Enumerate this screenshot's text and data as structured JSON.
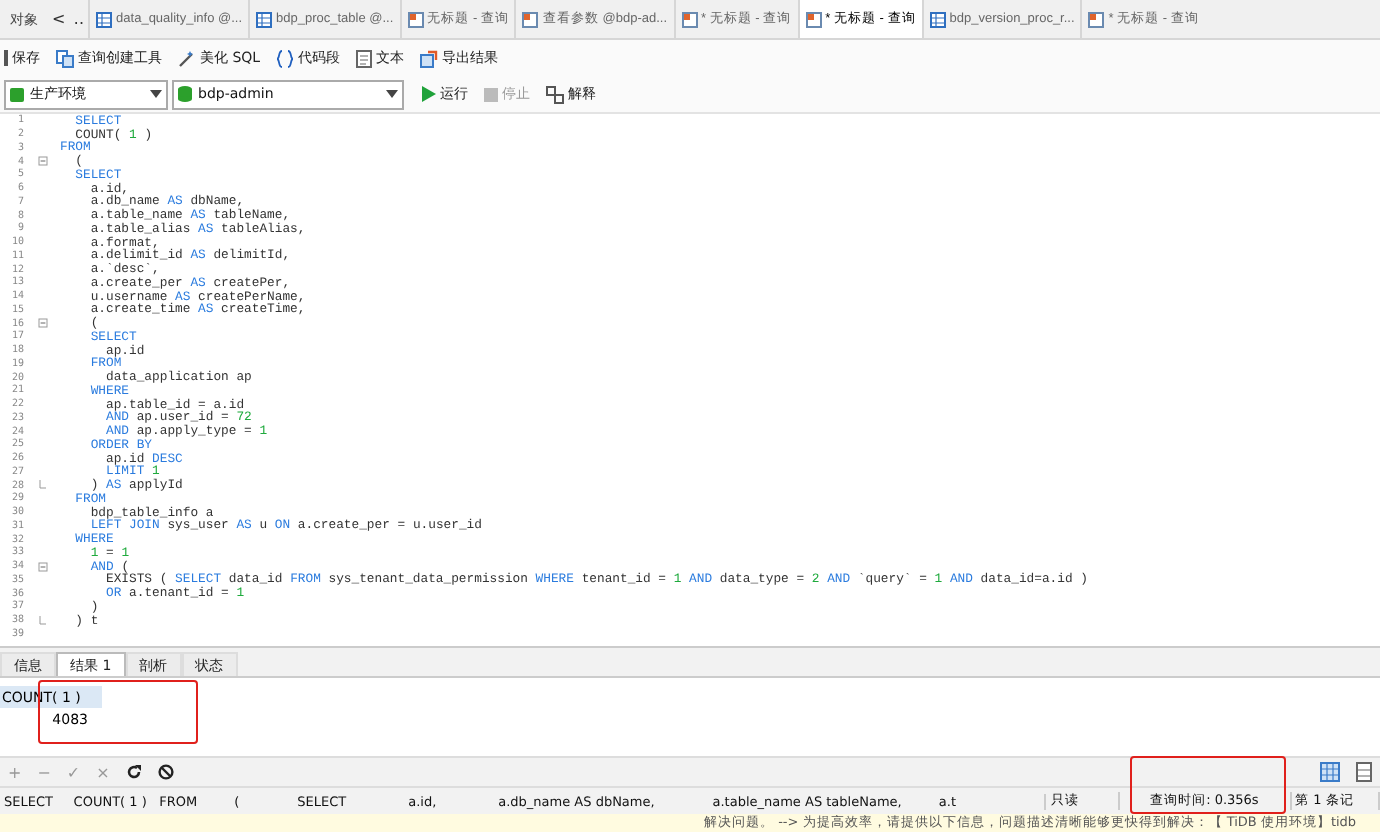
{
  "doc_tabs": {
    "objects_label": "对象",
    "nav": [
      "<",
      "‥"
    ],
    "items": [
      {
        "label": "data_quality_info @...",
        "kind": "table",
        "selected": false
      },
      {
        "label": "bdp_proc_table @...",
        "kind": "table",
        "selected": false
      },
      {
        "label": "无标题 - 查询",
        "kind": "query",
        "selected": false
      },
      {
        "label": "查看参数 @bdp-ad...",
        "kind": "query",
        "selected": false
      },
      {
        "label": "* 无标题 - 查询",
        "kind": "query",
        "selected": false
      },
      {
        "label": "* 无标题 - 查询",
        "kind": "query",
        "selected": true
      },
      {
        "label": "bdp_version_proc_r...",
        "kind": "table",
        "selected": false
      },
      {
        "label": "* 无标题 - 查询",
        "kind": "query",
        "selected": false
      }
    ]
  },
  "toolbar": [
    "保存",
    "查询创建工具",
    "美化 SQL",
    "代码段",
    "文本",
    "导出结果"
  ],
  "connection": {
    "environment": "生产环境",
    "database": "bdp-admin"
  },
  "run_bar": [
    {
      "label": "运行",
      "disabled": false
    },
    {
      "label": "停止",
      "disabled": true
    },
    {
      "label": "解释",
      "disabled": false
    }
  ],
  "code": [
    {
      "n": "1",
      "s": [
        {
          "t": "  SELECT",
          "kind": "kw"
        }
      ]
    },
    {
      "n": "2",
      "s": [
        {
          "t": "  COUNT( ",
          "kind": "p"
        },
        {
          "t": "1",
          "kind": "num"
        },
        {
          "t": " )",
          "kind": "p"
        }
      ]
    },
    {
      "n": "3",
      "s": [
        {
          "t": "FROM",
          "kind": "kw"
        }
      ]
    },
    {
      "n": "4",
      "kind": "fold",
      "s": [
        {
          "t": "  (",
          "kind": "p"
        }
      ]
    },
    {
      "n": "5",
      "s": [
        {
          "t": "  SELECT",
          "kind": "kw"
        }
      ]
    },
    {
      "n": "6",
      "s": [
        {
          "t": "    a.id,",
          "kind": "p"
        }
      ]
    },
    {
      "n": "7",
      "s": [
        {
          "t": "    a.db_name ",
          "kind": "p"
        },
        {
          "t": "AS",
          "kind": "kw"
        },
        {
          "t": " dbName,",
          "kind": "p"
        }
      ]
    },
    {
      "n": "8",
      "s": [
        {
          "t": "    a.table_name ",
          "kind": "p"
        },
        {
          "t": "AS",
          "kind": "kw"
        },
        {
          "t": " tableName,",
          "kind": "p"
        }
      ]
    },
    {
      "n": "9",
      "s": [
        {
          "t": "    a.table_alias ",
          "kind": "p"
        },
        {
          "t": "AS",
          "kind": "kw"
        },
        {
          "t": " tableAlias,",
          "kind": "p"
        }
      ]
    },
    {
      "n": "10",
      "s": [
        {
          "t": "    a.format,",
          "kind": "p"
        }
      ]
    },
    {
      "n": "11",
      "s": [
        {
          "t": "    a.delimit_id ",
          "kind": "p"
        },
        {
          "t": "AS",
          "kind": "kw"
        },
        {
          "t": " delimitId,",
          "kind": "p"
        }
      ]
    },
    {
      "n": "12",
      "s": [
        {
          "t": "    a.`desc`,",
          "kind": "p"
        }
      ]
    },
    {
      "n": "13",
      "s": [
        {
          "t": "    a.create_per ",
          "kind": "p"
        },
        {
          "t": "AS",
          "kind": "kw"
        },
        {
          "t": " createPer,",
          "kind": "p"
        }
      ]
    },
    {
      "n": "14",
      "s": [
        {
          "t": "    u.username ",
          "kind": "p"
        },
        {
          "t": "AS",
          "kind": "kw"
        },
        {
          "t": " createPerName,",
          "kind": "p"
        }
      ]
    },
    {
      "n": "15",
      "s": [
        {
          "t": "    a.create_time ",
          "kind": "p"
        },
        {
          "t": "AS",
          "kind": "kw"
        },
        {
          "t": " createTime,",
          "kind": "p"
        }
      ]
    },
    {
      "n": "16",
      "kind": "fold",
      "s": [
        {
          "t": "    (",
          "kind": "p"
        }
      ]
    },
    {
      "n": "17",
      "s": [
        {
          "t": "    SELECT",
          "kind": "kw"
        }
      ]
    },
    {
      "n": "18",
      "s": [
        {
          "t": "      ap.id",
          "kind": "p"
        }
      ]
    },
    {
      "n": "19",
      "s": [
        {
          "t": "    FROM",
          "kind": "kw"
        }
      ]
    },
    {
      "n": "20",
      "s": [
        {
          "t": "      data_application ap",
          "kind": "p"
        }
      ]
    },
    {
      "n": "21",
      "s": [
        {
          "t": "    WHERE",
          "kind": "kw"
        }
      ]
    },
    {
      "n": "22",
      "s": [
        {
          "t": "      ap.table_id = a.id",
          "kind": "p"
        }
      ]
    },
    {
      "n": "23",
      "s": [
        {
          "t": "      AND",
          "kind": "kw"
        },
        {
          "t": " ap.user_id = ",
          "kind": "p"
        },
        {
          "t": "72",
          "kind": "num"
        }
      ]
    },
    {
      "n": "24",
      "s": [
        {
          "t": "      AND",
          "kind": "kw"
        },
        {
          "t": " ap.apply_type = ",
          "kind": "p"
        },
        {
          "t": "1",
          "kind": "num"
        }
      ]
    },
    {
      "n": "25",
      "s": [
        {
          "t": "    ORDER BY",
          "kind": "kw"
        }
      ]
    },
    {
      "n": "26",
      "s": [
        {
          "t": "      ap.id ",
          "kind": "p"
        },
        {
          "t": "DESC",
          "kind": "kw"
        }
      ]
    },
    {
      "n": "27",
      "s": [
        {
          "t": "      LIMIT",
          "kind": "kw"
        },
        {
          "t": " 1",
          "kind": "num"
        }
      ]
    },
    {
      "n": "28",
      "kind": "fold_end",
      "s": [
        {
          "t": "    ) ",
          "kind": "p"
        },
        {
          "t": "AS",
          "kind": "kw"
        },
        {
          "t": " applyId",
          "kind": "p"
        }
      ]
    },
    {
      "n": "29",
      "s": [
        {
          "t": "  FROM",
          "kind": "kw"
        }
      ]
    },
    {
      "n": "30",
      "s": [
        {
          "t": "    bdp_table_info a",
          "kind": "p"
        }
      ]
    },
    {
      "n": "31",
      "s": [
        {
          "t": "    LEFT JOIN",
          "kind": "kw"
        },
        {
          "t": " sys_user ",
          "kind": "p"
        },
        {
          "t": "AS",
          "kind": "kw"
        },
        {
          "t": " u ",
          "kind": "p"
        },
        {
          "t": "ON",
          "kind": "kw"
        },
        {
          "t": " a.create_per = u.user_id",
          "kind": "p"
        }
      ]
    },
    {
      "n": "32",
      "s": [
        {
          "t": "  WHERE",
          "kind": "kw"
        }
      ]
    },
    {
      "n": "33",
      "s": [
        {
          "t": "    1",
          "kind": "num"
        },
        {
          "t": " = ",
          "kind": "p"
        },
        {
          "t": "1",
          "kind": "num"
        }
      ]
    },
    {
      "n": "34",
      "kind": "fold",
      "s": [
        {
          "t": "    AND",
          "kind": "kw"
        },
        {
          "t": " (",
          "kind": "p"
        }
      ]
    },
    {
      "n": "35",
      "s": [
        {
          "t": "      EXISTS ( ",
          "kind": "p"
        },
        {
          "t": "SELECT",
          "kind": "kw"
        },
        {
          "t": " data_id ",
          "kind": "p"
        },
        {
          "t": "FROM",
          "kind": "kw"
        },
        {
          "t": " sys_tenant_data_permission ",
          "kind": "p"
        },
        {
          "t": "WHERE",
          "kind": "kw"
        },
        {
          "t": " tenant_id = ",
          "kind": "p"
        },
        {
          "t": "1",
          "kind": "num"
        },
        {
          "t": " AND",
          "kind": "kw"
        },
        {
          "t": " data_type = ",
          "kind": "p"
        },
        {
          "t": "2",
          "kind": "num"
        },
        {
          "t": " AND",
          "kind": "kw"
        },
        {
          "t": " `query` = ",
          "kind": "p"
        },
        {
          "t": "1",
          "kind": "num"
        },
        {
          "t": " AND",
          "kind": "kw"
        },
        {
          "t": " data_id=a.id )",
          "kind": "p"
        }
      ]
    },
    {
      "n": "36",
      "s": [
        {
          "t": "      OR",
          "kind": "kw"
        },
        {
          "t": " a.tenant_id = ",
          "kind": "p"
        },
        {
          "t": "1",
          "kind": "num"
        }
      ]
    },
    {
      "n": "37",
      "s": [
        {
          "t": "    )",
          "kind": "p"
        }
      ]
    },
    {
      "n": "38",
      "kind": "fold_end",
      "s": [
        {
          "t": "  ) t",
          "kind": "p"
        }
      ]
    },
    {
      "n": "39"
    }
  ],
  "result_tabs": [
    {
      "label": "信息",
      "selected": false
    },
    {
      "label": "结果 1",
      "selected": true
    },
    {
      "label": "剖析",
      "selected": false
    },
    {
      "label": "状态",
      "selected": false
    }
  ],
  "result_grid": {
    "columns": [
      "COUNT( 1 )"
    ],
    "rows": [
      [
        "4083"
      ]
    ]
  },
  "grid_controls": [
    "+",
    "−",
    "✓",
    "×"
  ],
  "status_bar": {
    "sql": "SELECT     COUNT( 1 )   FROM         (              SELECT               a.id,               a.db_name AS dbName,              a.table_name AS tableName,         a.t",
    "mode": "只读",
    "query_time": "查询时间: 0.356s",
    "record": "第 1 条记"
  },
  "page_footer": "解决问题。 --> 为提高效率，请提供以下信息，问题描述清晰能够更快得到解决：【 TiDB 使用环境】tidb"
}
